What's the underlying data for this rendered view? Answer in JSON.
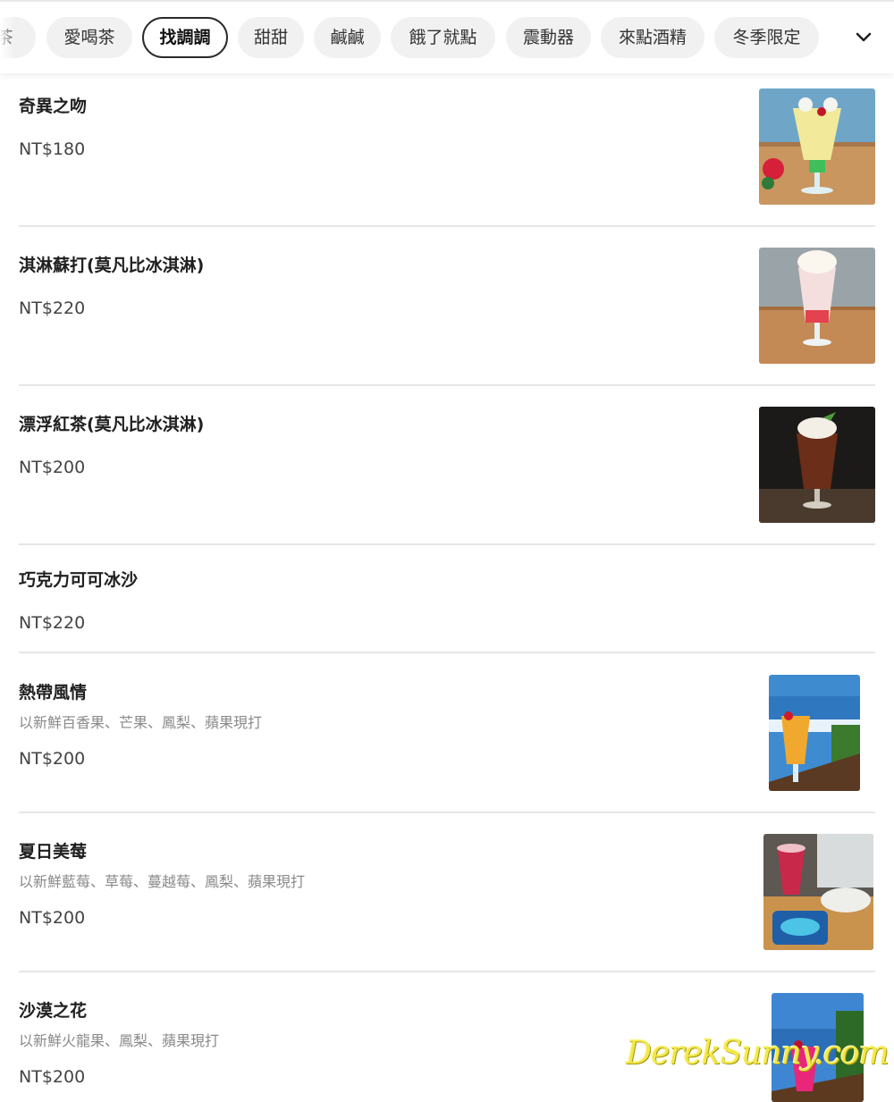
{
  "categories": {
    "items": [
      "茶",
      "愛喝茶",
      "找調調",
      "甜甜",
      "鹹鹹",
      "餓了就點",
      "震動器",
      "來點酒精",
      "冬季限定"
    ],
    "active_index": 2,
    "more_icon": "chevron-down-icon"
  },
  "menu": {
    "items": [
      {
        "name": "奇異之吻",
        "desc": "",
        "price": "NT$180",
        "photo": "drink-photo"
      },
      {
        "name": "淇淋蘇打(莫凡比冰淇淋)",
        "desc": "",
        "price": "NT$220",
        "photo": "drink-photo"
      },
      {
        "name": "漂浮紅茶(莫凡比冰淇淋)",
        "desc": "",
        "price": "NT$200",
        "photo": "drink-photo"
      },
      {
        "name": "巧克力可可冰沙",
        "desc": "",
        "price": "NT$220"
      },
      {
        "name": "熱帶風情",
        "desc": "以新鮮百香果、芒果、鳳梨、蘋果現打",
        "price": "NT$200",
        "photo": "drink-photo"
      },
      {
        "name": "夏日美莓",
        "desc": "以新鮮藍莓、草莓、蔓越莓、鳳梨、蘋果現打",
        "price": "NT$200",
        "photo": "drink-photo"
      },
      {
        "name": "沙漠之花",
        "desc": "以新鮮火龍果、鳳梨、蘋果現打",
        "price": "NT$200",
        "photo": "drink-photo"
      }
    ]
  },
  "watermark": "DerekSunny.com",
  "colors": {
    "pill_bg": "#f1f1f1",
    "active_border": "#2a2a2a",
    "divider": "#e6e6e6",
    "price_text": "#444444",
    "desc_text": "#8a8a8a",
    "watermark": "#f2e84a"
  }
}
